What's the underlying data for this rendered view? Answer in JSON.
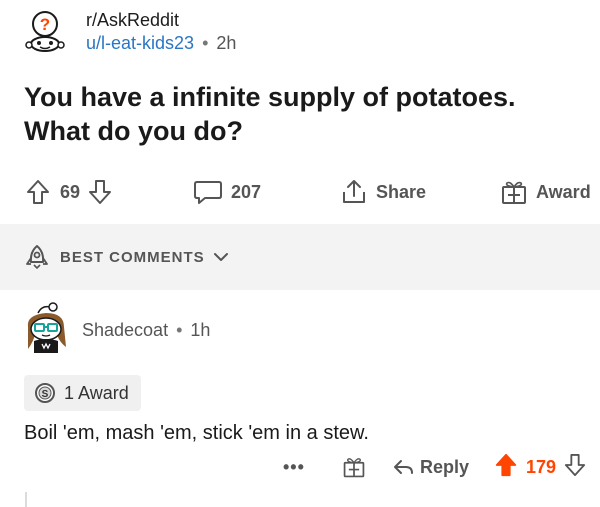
{
  "post": {
    "subreddit": "r/AskReddit",
    "author": "u/l-eat-kids23",
    "separator": "•",
    "age": "2h",
    "title": "You have a infinite supply of potatoes. What do you do?"
  },
  "actions": {
    "upvote_icon": "upvote-arrow-icon",
    "votes": "69",
    "comments": "207",
    "share_label": "Share",
    "award_label": "Award"
  },
  "sort": {
    "label": "BEST COMMENTS"
  },
  "comment": {
    "author": "Shadecoat",
    "separator": "•",
    "age": "1h",
    "award_text": "1 Award",
    "body": "Boil 'em, mash 'em, stick 'em in a stew.",
    "more": "•••",
    "reply_label": "Reply",
    "votes": "179"
  },
  "colors": {
    "upvoted": "#ff4500",
    "username_link": "#2a76c4",
    "sort_band": "#f3f3f4"
  }
}
